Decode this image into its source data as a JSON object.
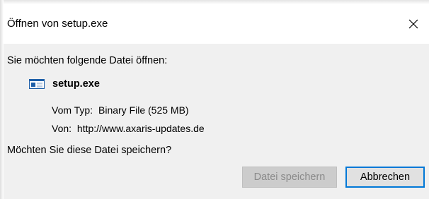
{
  "window": {
    "title": "Öffnen von setup.exe",
    "close_icon": "close-icon"
  },
  "content": {
    "prompt": "Sie möchten folgende Datei öffnen:",
    "file": {
      "icon": "executable-file-icon",
      "name": "setup.exe"
    },
    "details": {
      "type_label": "Vom Typ:",
      "type_value": "Binary File (525 MB)",
      "from_label": "Von:",
      "from_value": "http://www.axaris-updates.de"
    },
    "question": "Möchten Sie diese Datei speichern?"
  },
  "buttons": {
    "save_label": "Datei speichern",
    "save_disabled": true,
    "cancel_label": "Abbrechen"
  },
  "colors": {
    "body_background": "#f0f0f0",
    "focus_border": "#0078d7",
    "disabled_text": "#8a8a8a"
  }
}
